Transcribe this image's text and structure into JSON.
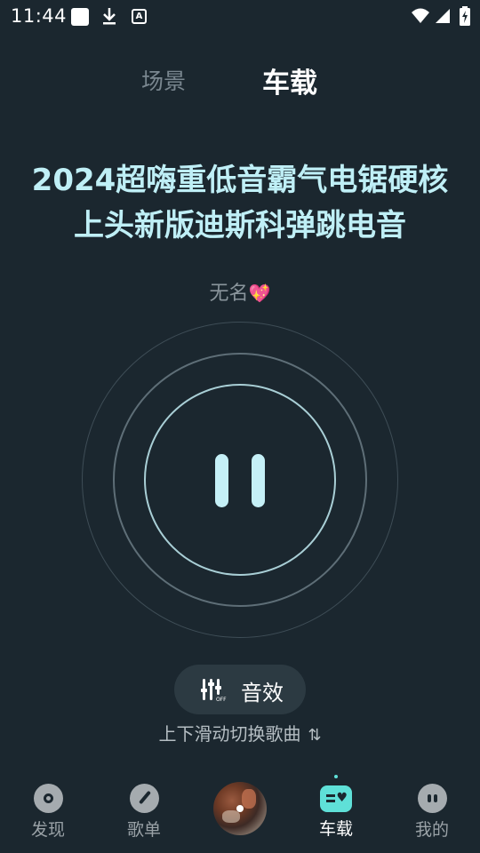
{
  "status_bar": {
    "time": "11:44",
    "icons": [
      "notification-square-icon",
      "download-icon",
      "a-icon",
      "wifi-icon",
      "signal-icon",
      "battery-icon"
    ]
  },
  "top_tabs": {
    "scene": "场景",
    "car": "车载"
  },
  "song": {
    "title_line1": "2024超嗨重低音霸气电锯硬核",
    "title_line2": "上头新版迪斯科弹跳电音",
    "artist": "无名",
    "artist_emoji": "💖"
  },
  "player": {
    "state": "playing",
    "control_icon": "pause-icon"
  },
  "sound_effect": {
    "label": "音效",
    "icon": "equalizer-off-icon"
  },
  "swipe_hint": {
    "text": "上下滑动切换歌曲",
    "icon": "swap-vertical-icon"
  },
  "bottom_nav": {
    "items": [
      {
        "label": "发现",
        "icon": "disc-icon"
      },
      {
        "label": "歌单",
        "icon": "record-needle-icon"
      },
      {
        "label": "",
        "icon": "album-art"
      },
      {
        "label": "车载",
        "icon": "car-mode-icon",
        "active": true
      },
      {
        "label": "我的",
        "icon": "profile-face-icon"
      }
    ]
  },
  "colors": {
    "background": "#1b272f",
    "title": "#bfeff6",
    "accent": "#5fe0d8"
  }
}
